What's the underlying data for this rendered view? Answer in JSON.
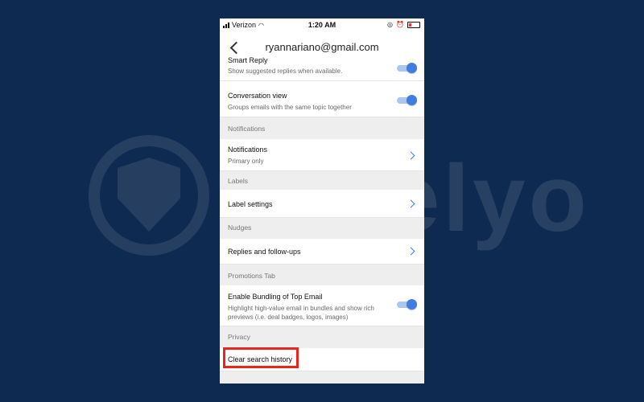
{
  "watermark": {
    "text": "Safelyo"
  },
  "status_bar": {
    "carrier": "Verizon",
    "time": "1:20 AM"
  },
  "header": {
    "title": "ryannariano@gmail.com",
    "back_icon": "chevron-left-icon"
  },
  "settings": {
    "smart_reply": {
      "title": "Smart Reply",
      "subtitle": "Show suggested replies when available.",
      "enabled": true
    },
    "conversation_view": {
      "title": "Conversation view",
      "subtitle": "Groups emails with the same topic together",
      "enabled": true
    },
    "notifications_section": "Notifications",
    "notifications": {
      "title": "Notifications",
      "subtitle": "Primary only"
    },
    "labels_section": "Labels",
    "label_settings": {
      "title": "Label settings"
    },
    "nudges_section": "Nudges",
    "replies_followups": {
      "title": "Replies and follow-ups"
    },
    "promotions_section": "Promotions Tab",
    "bundling": {
      "title": "Enable Bundling of Top Email",
      "subtitle": "Highlight high-value email in bundles and show rich previews (i.e. deal badges, logos, images)",
      "enabled": true
    },
    "privacy_section": "Privacy",
    "clear_search_history": {
      "title": "Clear search history"
    }
  },
  "colors": {
    "background": "#0e2a50",
    "accent": "#3f7de0",
    "highlight_box": "#e8261b"
  }
}
